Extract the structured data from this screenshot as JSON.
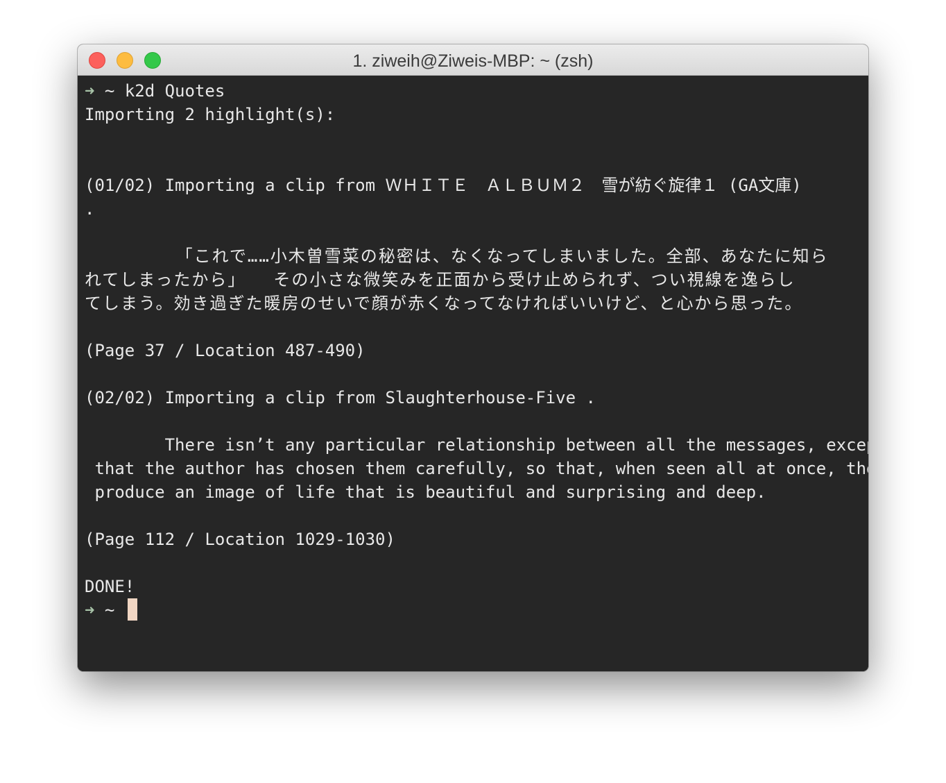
{
  "window": {
    "title": "1. ziweih@Ziweis-MBP: ~ (zsh)"
  },
  "terminal": {
    "prompt_symbol": "➜",
    "prompt_dir": " ~ ",
    "command": "k2d Quotes",
    "lines": {
      "importing": "Importing 2 highlight(s):",
      "clip1_header": "(01/02) Importing a clip from ＷＨＩＴＥ　ＡＬＢＵＭ２　雪が紡ぐ旋律１ (GA文庫)",
      "clip1_dot": ".",
      "clip1_q1": "        「これで……小木曽雪菜の秘密は、なくなってしまいました。全部、あなたに知ら",
      "clip1_q2": "れてしまったから」　　その小さな微笑みを正面から受け止められず、つい視線を逸らし",
      "clip1_q3": "てしまう。効き過ぎた暖房のせいで顔が赤くなってなければいいけど、と心から思った。",
      "clip1_loc": "(Page 37 / Location 487-490)",
      "clip2_header": "(02/02) Importing a clip from Slaughterhouse-Five .",
      "clip2_q1": "        There isn’t any particular relationship between all the messages, except",
      "clip2_q2": " that the author has chosen them carefully, so that, when seen all at once, they",
      "clip2_q3": " produce an image of life that is beautiful and surprising and deep.",
      "clip2_loc": "(Page 112 / Location 1029-1030)",
      "done": "DONE!"
    }
  },
  "colors": {
    "terminal_bg": "#262626",
    "text": "#e8e8e8",
    "prompt_arrow": "#a8c3a8",
    "cursor": "#f1d6c3"
  }
}
